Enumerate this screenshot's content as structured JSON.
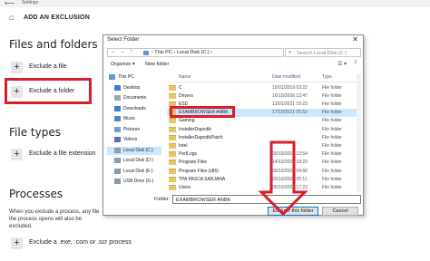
{
  "window": {
    "title": "Settings",
    "back_glyph": "⟵"
  },
  "header": {
    "title": "ADD AN EXCLUSION",
    "home_glyph": "⌂"
  },
  "files_and_folders": {
    "title": "Files and folders",
    "exclude_file": "Exclude a file",
    "exclude_folder": "Exclude a folder"
  },
  "file_types": {
    "title": "File types",
    "exclude_extension": "Exclude a file extension"
  },
  "processes": {
    "title": "Processes",
    "info": "When you exclude a process, any file the process opens will also be excluded.",
    "exclude_process": "Exclude a .exe, .com or .scr process"
  },
  "plus_glyph": "+",
  "dialog": {
    "title": "Select Folder",
    "close_glyph": "✕",
    "address": {
      "back_glyph": "←",
      "forward_glyph": "→",
      "up_glyph": "↑",
      "path": "›  This PC  ›  Local Disk (C:)  ›"
    },
    "search_placeholder": "Search Local Disk (C:)",
    "search_glyph": "⌕",
    "toolbar": {
      "organize": "Organize ▾",
      "new_folder": "New folder",
      "view_glyph": "☰ ▾",
      "help_glyph": "?"
    },
    "tree": [
      {
        "label": "This PC",
        "color": "#5b9bd5"
      },
      {
        "label": "Desktop",
        "color": "#3a7bd5"
      },
      {
        "label": "Documents",
        "color": "#9aa8b8"
      },
      {
        "label": "Downloads",
        "color": "#3a7bd5"
      },
      {
        "label": "Music",
        "color": "#4a86c8"
      },
      {
        "label": "Pictures",
        "color": "#6aa0d8"
      },
      {
        "label": "Videos",
        "color": "#5a6fb0"
      },
      {
        "label": "Local Disk (C:)",
        "color": "#8a9bb0"
      },
      {
        "label": "Local Disk (D:)",
        "color": "#8a9bb0"
      },
      {
        "label": "Local Disk (E:)",
        "color": "#8a9bb0"
      },
      {
        "label": "USB Drive (G:)",
        "color": "#8a9bb0"
      }
    ],
    "columns": {
      "name": "Name",
      "date": "Date modified",
      "type": "Type"
    },
    "files": [
      {
        "name": "C",
        "date": "15/01/2019 03:22",
        "type": "File folder"
      },
      {
        "name": "Drivers",
        "date": "16/10/2016 13:47",
        "type": "File folder"
      },
      {
        "name": "ESD",
        "date": "12/01/2021 15:23",
        "type": "File folder"
      },
      {
        "name": "EXAMBROWSER ANBK",
        "date": "17/10/2021 05:52",
        "type": "File folder"
      },
      {
        "name": "Gaming",
        "date": "",
        "type": "File folder"
      },
      {
        "name": "InstallerDapodik",
        "date": "",
        "type": "File folder"
      },
      {
        "name": "InstallerDapodikPatch",
        "date": "",
        "type": "File folder"
      },
      {
        "name": "Intel",
        "date": "",
        "type": "File folder"
      },
      {
        "name": "PerfLogs",
        "date": "30/10/2015 13:54",
        "type": "File folder"
      },
      {
        "name": "Program Files",
        "date": "14/10/2021 18:23",
        "type": "File folder"
      },
      {
        "name": "Program Files (x86)",
        "date": "30/10/2021 04:58",
        "type": "File folder"
      },
      {
        "name": "TPA PASCA SARJANA",
        "date": "20/10/2021 05:11",
        "type": "File folder"
      },
      {
        "name": "Users",
        "date": "05/10/2021 17:23",
        "type": "File folder"
      }
    ],
    "folder_label": "Folder:",
    "folder_value": "EXAMBROWSER ANBK",
    "buttons": {
      "exclude": "Exclude this folder",
      "cancel": "Cancel"
    }
  },
  "colors": {
    "highlight_red": "#d81e2a",
    "selection_blue": "#cce8ff",
    "folder_yellow": "#e9c46a"
  }
}
